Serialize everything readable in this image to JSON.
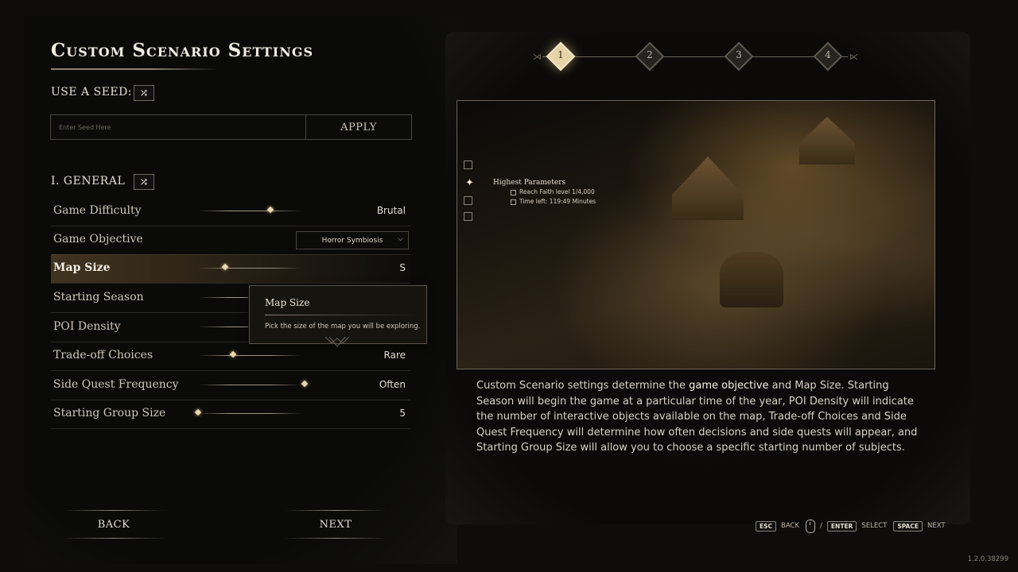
{
  "title": "Custom Scenario Settings",
  "seed": {
    "label": "USE A SEED:",
    "placeholder": "Enter Seed Here",
    "apply_label": "APPLY",
    "shuffle_icon": "shuffle-icon"
  },
  "general": {
    "label": "I. GENERAL",
    "settings": [
      {
        "name": "Game Difficulty",
        "value": "Brutal",
        "level": 0.68
      },
      {
        "name": "Game Objective",
        "value": "Horror Symbiosis"
      },
      {
        "name": "Map Size",
        "value": "S",
        "level": 0.25
      },
      {
        "name": "Starting Season",
        "value": ""
      },
      {
        "name": "POI Density",
        "value": ""
      },
      {
        "name": "Trade-off Choices",
        "value": "Rare",
        "level": 0.33
      },
      {
        "name": "Side Quest Frequency",
        "value": "Often",
        "level": 1.0
      },
      {
        "name": "Starting Group Size",
        "value": "5",
        "level": 0.0
      }
    ]
  },
  "tooltip": {
    "title": "Map Size",
    "body": "Pick the size of the map you will be exploring."
  },
  "steps": [
    "1",
    "2",
    "3",
    "4"
  ],
  "active_step": 1,
  "preview": {
    "objective_title": "Highest Parameters",
    "objective_lines": [
      "Reach Faith level 1/4,000",
      "Time left: 119:49 Minutes"
    ]
  },
  "description": {
    "p1": "Custom Scenario settings determine the ",
    "hl1": "game objective",
    "p2": " and Map Size. Starting Season will begin the game at a particular time of the year, POI Density will indicate the number of interactive objects available on the map, Trade-off Choices and Side Quest Frequency will determine how often decisions and side quests will appear, and Starting Group Size will allow you to choose a specific starting number of subjects."
  },
  "buttons": {
    "back": "BACK",
    "next": "NEXT"
  },
  "hints": {
    "esc": "ESC",
    "back": "BACK",
    "slash": "/",
    "enter": "ENTER",
    "select": "SELECT",
    "space": "SPACE",
    "next": "NEXT"
  },
  "version": "1.2.0.38299",
  "colors": {
    "accent": "#e6d3a8",
    "background": "#0e0d0c",
    "text": "#d9d2c5"
  }
}
